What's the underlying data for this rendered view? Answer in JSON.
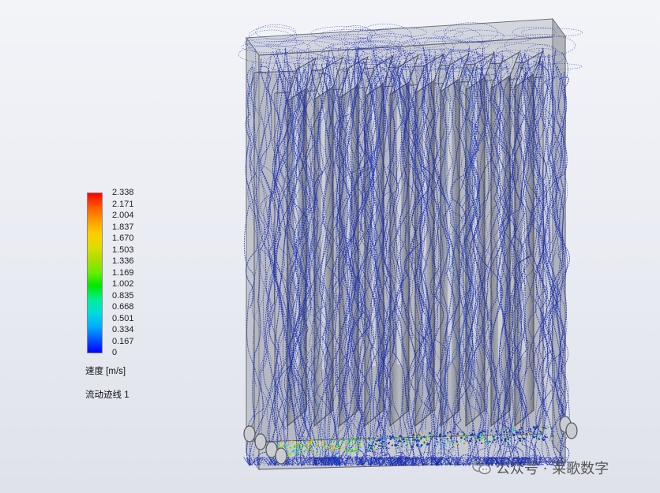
{
  "legend": {
    "ticks": [
      "2.338",
      "2.171",
      "2.004",
      "1.837",
      "1.670",
      "1.503",
      "1.336",
      "1.169",
      "1.002",
      "0.835",
      "0.668",
      "0.501",
      "0.334",
      "0.167",
      "0"
    ],
    "unit_label": "速度 [m/s]",
    "trace_label": "流动迹线 1",
    "colors": [
      "#0000ff",
      "#00aaff",
      "#00e600",
      "#dddd00",
      "#ff9900",
      "#ff0000"
    ]
  },
  "watermark": {
    "text": "公众号 · 莱歌数字"
  },
  "colors": {
    "housing": "#b9bcc4",
    "fin": "#9a9da4",
    "streamline": "#1c2fb5"
  }
}
